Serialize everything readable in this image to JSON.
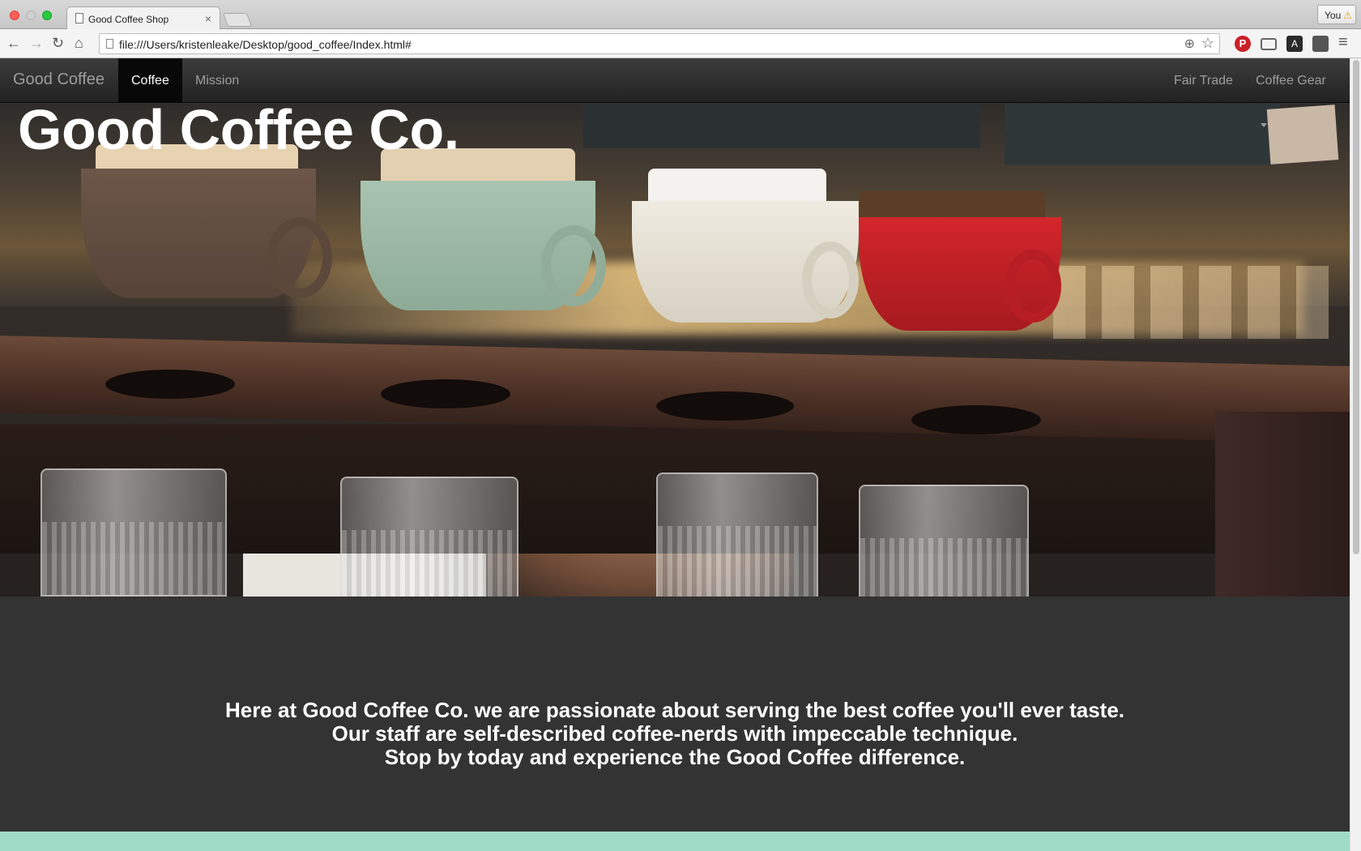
{
  "browser": {
    "tab_title": "Good Coffee Shop",
    "tab_close": "×",
    "profile_name": "You",
    "profile_warning": "⚠",
    "url": "file:///Users/kristenleake/Desktop/good_coffee/Index.html#",
    "icons": [
      "back-arrow-icon",
      "forward-arrow-icon",
      "reload-icon",
      "home-icon",
      "page-icon",
      "zoom-icon",
      "bookmark-star-icon",
      "pinterest-icon",
      "cast-icon",
      "dictionary-icon",
      "shield-icon",
      "menu-icon"
    ],
    "glyphs": {
      "back": "←",
      "forward": "→",
      "reload": "↻",
      "home": "⌂",
      "zoom": "⊕",
      "star": "☆",
      "pinterest": "P",
      "dict": "A",
      "menu": "≡"
    }
  },
  "navbar": {
    "brand": "Good Coffee",
    "items": [
      {
        "label": "Coffee",
        "active": true
      },
      {
        "label": "Mission",
        "active": false
      },
      {
        "label": "Fair Trade",
        "active": false
      },
      {
        "label": "Coffee Gear",
        "active": false,
        "dropdown": true
      }
    ],
    "colors": {
      "background": "#222222",
      "active": "#080808",
      "text": "#9d9d9d"
    }
  },
  "hero": {
    "title": "Good Coffee Co."
  },
  "intro": {
    "lines": [
      "Here at Good Coffee Co. we are passionate about serving the best coffee you'll ever taste.",
      "Our staff are self-described coffee-nerds with impeccable technique.",
      "Stop by today and experience the Good Coffee difference."
    ],
    "colors": {
      "background": "#333333",
      "next_section": "#9fdcc8"
    }
  }
}
